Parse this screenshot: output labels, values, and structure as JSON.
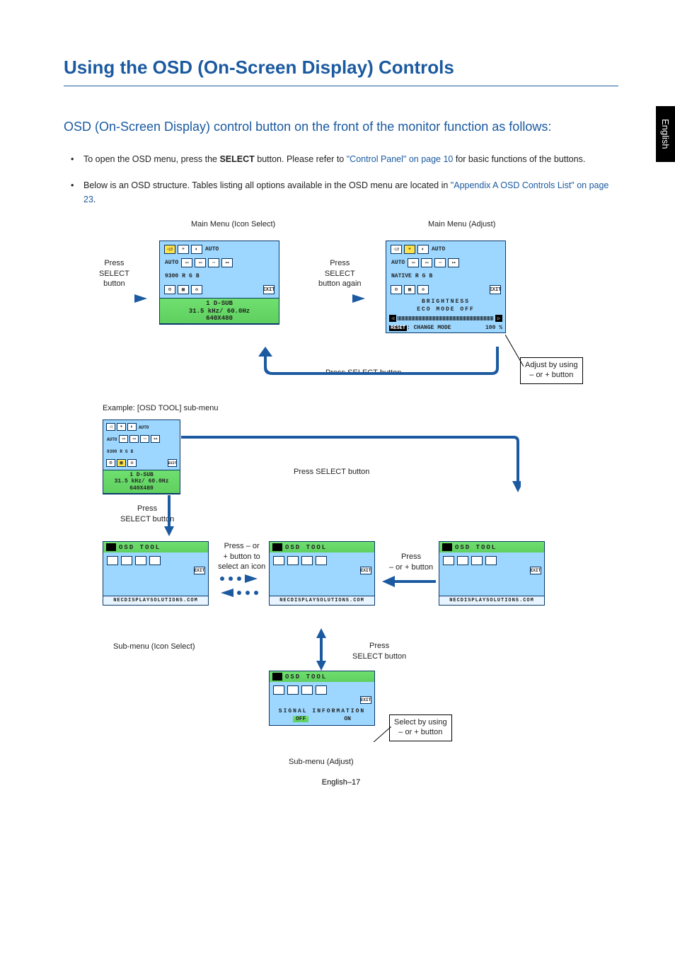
{
  "sideTab": "English",
  "title": "Using the OSD (On-Screen Display) Controls",
  "subtitle": "OSD (On-Screen Display) control button on the front of the monitor function as follows:",
  "bullets": {
    "b1_pre": "To open the OSD menu, press the ",
    "b1_bold": "SELECT",
    "b1_mid": " button. Please refer to ",
    "b1_link": "\"Control Panel\" on page 10",
    "b1_post": " for basic functions of the buttons.",
    "b2_pre": "Below is an OSD structure. Tables listing all options available in the OSD menu are located in ",
    "b2_link": "\"Appendix A OSD Controls List\" on page 23",
    "b2_post": "."
  },
  "labels": {
    "mainIconSelect": "Main Menu (Icon Select)",
    "mainAdjust": "Main Menu (Adjust)",
    "pressSelect": "Press\nSELECT\nbutton",
    "pressSelectAgain": "Press\nSELECT\nbutton again",
    "pressSelectBtn": "Press SELECT button",
    "adjustByPM": "Adjust by using\n– or + button",
    "exampleSub": "Example: [OSD TOOL] sub-menu",
    "pressSelectBelow": "Press\nSELECT button",
    "subIconSelect": "Sub-menu (Icon Select)",
    "pressPM": "Press – or\n+ button to\nselect an icon",
    "pressPMshort": "Press\n– or + button",
    "pressSelectBtn2": "Press\nSELECT button",
    "subAdjust": "Sub-menu (Adjust)",
    "selectByPM": "Select by using\n– or + button"
  },
  "osd": {
    "dsub": "1   D-SUB",
    "freq": "31.5 kHz/ 60.0Hz",
    "res": "640X480",
    "brightness": "BRIGHTNESS",
    "ecoOff": "ECO MODE OFF",
    "changeMode": ": CHANGE MODE",
    "reset": "RESET",
    "pct": "100 %",
    "native": "NATIVE",
    "k9300": "9300",
    "r": "R",
    "g": "G",
    "b": "B",
    "exit": "EXIT",
    "osdTool": "OSD TOOL",
    "footer": "NECDISPLAYSOLUTIONS.COM",
    "sigInfo": "SIGNAL INFORMATION",
    "off": "OFF",
    "on": "ON"
  },
  "pageNum": "English–17"
}
